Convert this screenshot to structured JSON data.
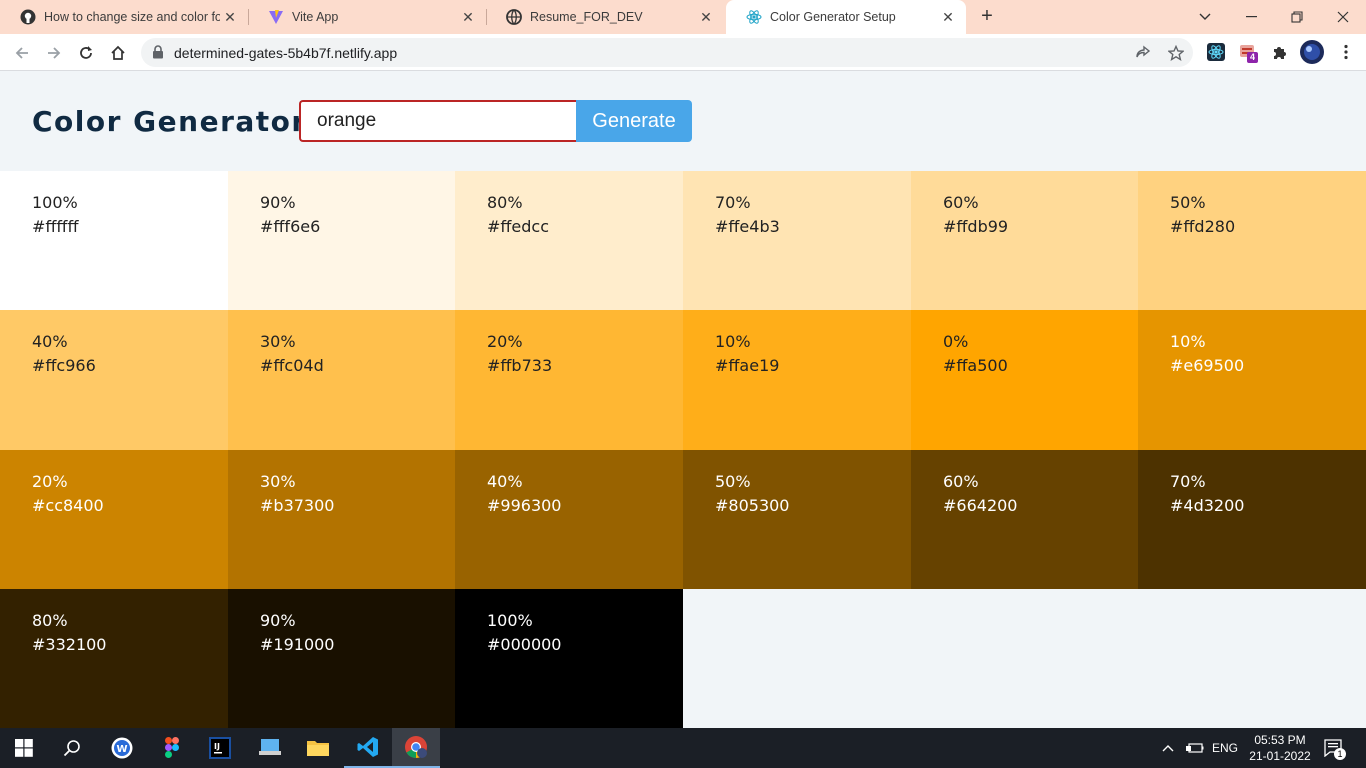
{
  "browser": {
    "tabs": [
      {
        "title": "How to change size and color for",
        "icon": "github-icon",
        "active": false
      },
      {
        "title": "Vite App",
        "icon": "vite-icon",
        "active": false
      },
      {
        "title": "Resume_FOR_DEV",
        "icon": "globe-icon",
        "active": false
      },
      {
        "title": "Color Generator Setup",
        "icon": "react-icon",
        "active": true
      }
    ],
    "url": "determined-gates-5b4b7f.netlify.app",
    "extension_badge": "4"
  },
  "app": {
    "title": "Color Generator",
    "input_value": "orange",
    "button_label": "Generate"
  },
  "swatches": [
    {
      "percent": "100%",
      "hex": "#ffffff",
      "text": "#222222"
    },
    {
      "percent": "90%",
      "hex": "#fff6e6",
      "text": "#222222"
    },
    {
      "percent": "80%",
      "hex": "#ffedcc",
      "text": "#222222"
    },
    {
      "percent": "70%",
      "hex": "#ffe4b3",
      "text": "#222222"
    },
    {
      "percent": "60%",
      "hex": "#ffdb99",
      "text": "#222222"
    },
    {
      "percent": "50%",
      "hex": "#ffd280",
      "text": "#222222"
    },
    {
      "percent": "40%",
      "hex": "#ffc966",
      "text": "#222222"
    },
    {
      "percent": "30%",
      "hex": "#ffc04d",
      "text": "#222222"
    },
    {
      "percent": "20%",
      "hex": "#ffb733",
      "text": "#222222"
    },
    {
      "percent": "10%",
      "hex": "#ffae19",
      "text": "#222222"
    },
    {
      "percent": "0%",
      "hex": "#ffa500",
      "text": "#222222"
    },
    {
      "percent": "10%",
      "hex": "#e69500",
      "text": "#ffffff"
    },
    {
      "percent": "20%",
      "hex": "#cc8400",
      "text": "#ffffff"
    },
    {
      "percent": "30%",
      "hex": "#b37300",
      "text": "#ffffff"
    },
    {
      "percent": "40%",
      "hex": "#996300",
      "text": "#ffffff"
    },
    {
      "percent": "50%",
      "hex": "#805300",
      "text": "#ffffff"
    },
    {
      "percent": "60%",
      "hex": "#664200",
      "text": "#ffffff"
    },
    {
      "percent": "70%",
      "hex": "#4d3200",
      "text": "#ffffff"
    },
    {
      "percent": "80%",
      "hex": "#332100",
      "text": "#ffffff"
    },
    {
      "percent": "90%",
      "hex": "#191000",
      "text": "#ffffff"
    },
    {
      "percent": "100%",
      "hex": "#000000",
      "text": "#ffffff"
    }
  ],
  "taskbar": {
    "language": "ENG",
    "time": "05:53 PM",
    "date": "21-01-2022",
    "notification_count": "1"
  }
}
